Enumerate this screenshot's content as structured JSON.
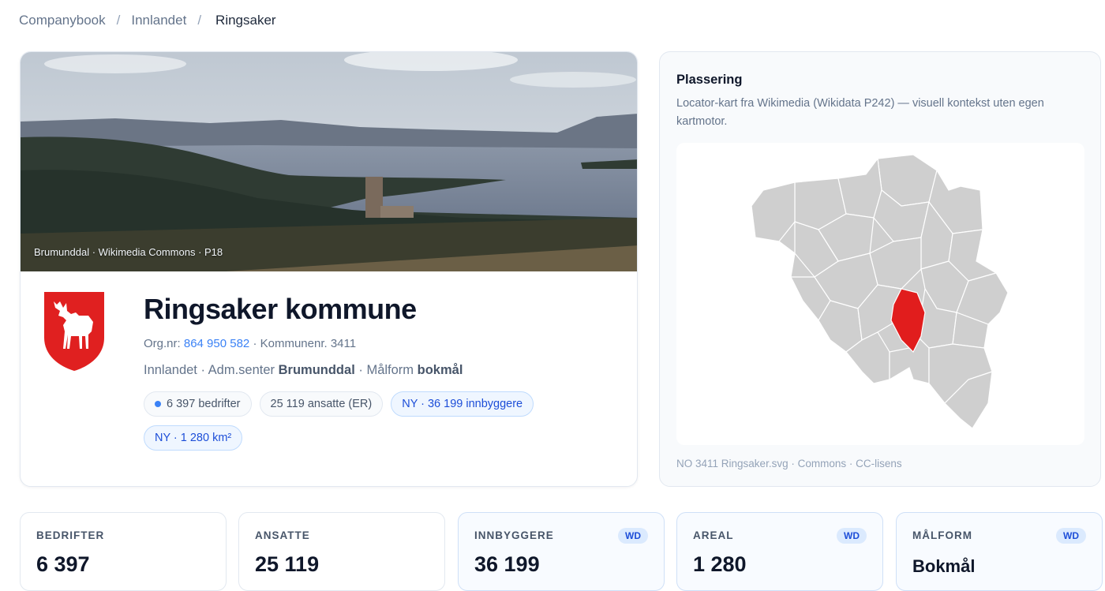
{
  "breadcrumb": {
    "items": [
      "Companybook",
      "Innlandet"
    ],
    "current": "Ringsaker"
  },
  "hero": {
    "photo_caption": "Brumunddal · Wikimedia Commons · P18",
    "title": "Ringsaker kommune",
    "org_label": "Org.nr:",
    "org_number": "864 950 582",
    "kommune_label": "· Kommunenr. 3411",
    "region": "Innlandet · Adm.senter",
    "admin_center": "Brumunddal",
    "maalform_label": "· Målform",
    "maalform": "bokmål",
    "pills": {
      "bedrifter": "6 397 bedrifter",
      "ansatte": "25 119 ansatte (ER)",
      "innbyggere": "NY · 36 199 innbyggere",
      "areal": "NY · 1 280 km²"
    }
  },
  "map": {
    "title": "Plassering",
    "description": "Locator-kart fra Wikimedia (Wikidata P242) — visuell kontekst uten egen kartmotor.",
    "caption": "NO 3411 Ringsaker.svg · Commons · CC-lisens",
    "highlight_color": "#e11d1d",
    "base_color": "#cfcfcf"
  },
  "stats": [
    {
      "label": "BEDRIFTER",
      "value": "6 397",
      "badge": ""
    },
    {
      "label": "ANSATTE",
      "value": "25 119",
      "badge": ""
    },
    {
      "label": "INNBYGGERE",
      "value": "36 199",
      "badge": "WD"
    },
    {
      "label": "AREAL",
      "value": "1 280",
      "badge": "WD"
    },
    {
      "label": "MÅLFORM",
      "value": "Bokmål",
      "badge": "WD"
    }
  ]
}
